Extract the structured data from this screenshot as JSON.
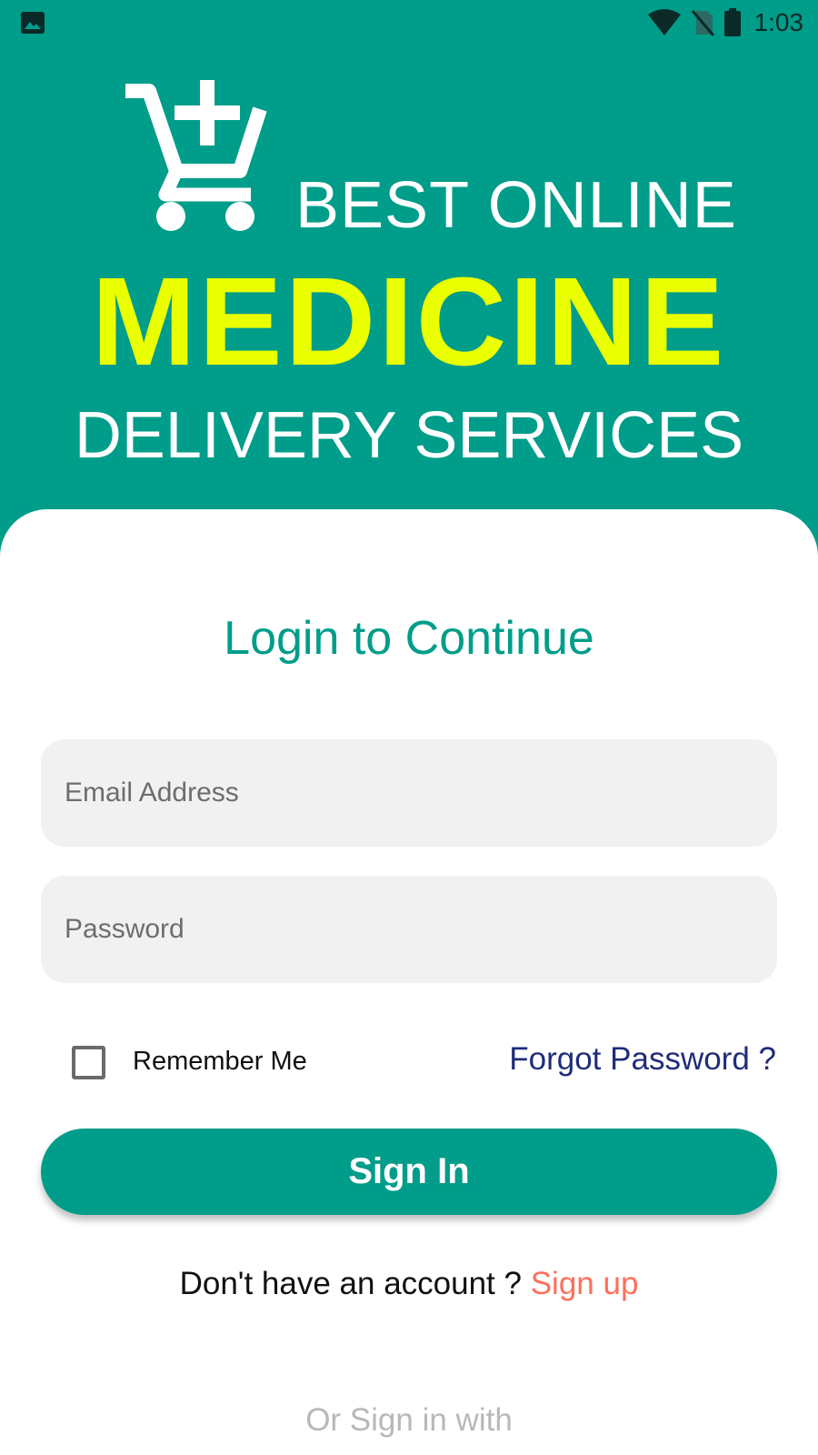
{
  "status_bar": {
    "left_icon": "image-notification-icon",
    "time": "1:03",
    "icons": [
      "wifi-icon",
      "no-sim-icon",
      "battery-icon"
    ]
  },
  "hero": {
    "logo_icon": "cart-plus-icon",
    "line1": "BEST ONLINE",
    "line2": "MEDICINE",
    "line3": "DELIVERY SERVICES"
  },
  "login": {
    "title": "Login to Continue",
    "email_placeholder": "Email Address",
    "password_placeholder": "Password",
    "remember_me": "Remember Me",
    "forgot_password": "Forgot Password ?",
    "sign_in": "Sign In",
    "no_account": "Don't have an account ? ",
    "sign_up": "Sign up",
    "alt_signin": "Or Sign in with"
  },
  "colors": {
    "primary": "#009d8a",
    "accent_yellow": "#eaff00",
    "link_blue": "#1f2d7a",
    "signup_red": "#ff6f5a"
  }
}
